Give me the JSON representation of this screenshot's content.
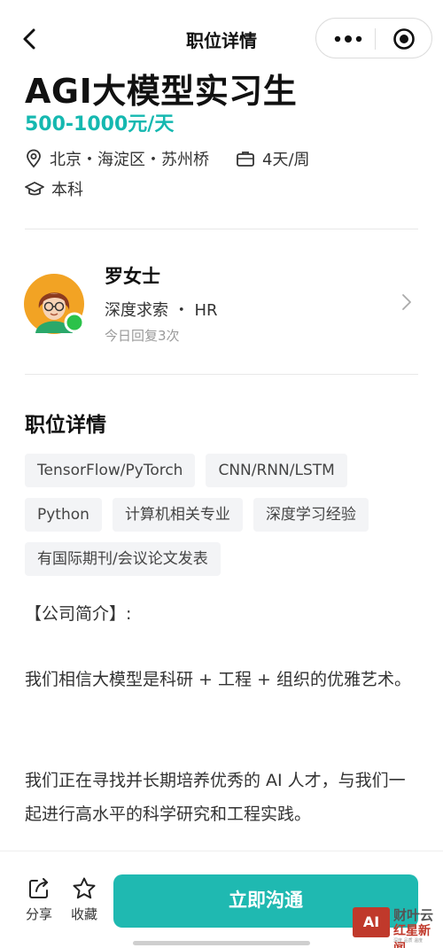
{
  "nav": {
    "title": "职位详情"
  },
  "job": {
    "title": "AGI大模型实习生",
    "salary": "500-1000元/天",
    "location": "北京・海淀区・苏州桥",
    "schedule": "4天/周",
    "education": "本科"
  },
  "recruiter": {
    "name": "罗女士",
    "company_role": "深度求索 ・ HR",
    "reply_info": "今日回复3次"
  },
  "details": {
    "section_title": "职位详情",
    "tags": [
      "TensorFlow/PyTorch",
      "CNN/RNN/LSTM",
      "Python",
      "计算机相关专业",
      "深度学习经验",
      "有国际期刊/会议论文发表"
    ],
    "paragraphs": [
      "【公司简介】:",
      "我们相信大模型是科研 + 工程 + 组织的优雅艺术。",
      "我们正在寻找并长期培养优秀的 AI 人才，与我们一起进行高水平的科学研究和工程实践。"
    ]
  },
  "bottom": {
    "share_label": "分享",
    "collect_label": "收藏",
    "cta_label": "立即沟通"
  },
  "watermark": {
    "logo": "AI",
    "line1": "财叶云",
    "line2": "红星新闻",
    "sub": "深度 品质 温度"
  },
  "colors": {
    "accent": "#15b8b0",
    "cta": "#1fb9b1",
    "online": "#2bc24a"
  },
  "icons": [
    "back-arrow-icon",
    "more-dots-icon",
    "target-icon",
    "location-pin-icon",
    "briefcase-icon",
    "graduation-cap-icon",
    "chevron-right-icon",
    "share-icon",
    "star-icon"
  ]
}
